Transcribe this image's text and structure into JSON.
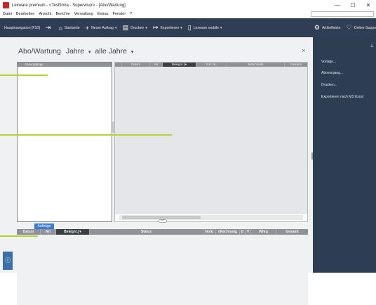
{
  "window": {
    "title": "Lexware premium - <Testfirma - Supervisor> - [Abo/Wartung]",
    "minimize": "—",
    "maximize": "☐",
    "close": "✕"
  },
  "menu": {
    "items": [
      "Datei",
      "Bearbeiten",
      "Ansicht",
      "Berichte",
      "Verwaltung",
      "Extras",
      "Fenster",
      "?"
    ]
  },
  "toolbar": {
    "nav": "Hauptnavigation [F10]",
    "startseite": "Startseite",
    "neuer_auftrag": "Neuer Auftrag",
    "drucken": "Drucken",
    "exportieren": "Exportieren",
    "lexware_mobile": "Lexware mobile",
    "artikelleiste": "Artikelleiste",
    "online_support": "Online Suppo"
  },
  "page": {
    "title": "Abo/Wartung",
    "year_label": "Jahre",
    "year_value": "alle Jahre",
    "close": "×"
  },
  "left_list": {
    "header": "Abovorgänge"
  },
  "grid": {
    "columns": [
      "",
      "Datum",
      "Art",
      "Belegnr.",
      "Ext. Nr.",
      "Matchcode",
      "Gesamt"
    ]
  },
  "orders": {
    "tab": "Aufträge",
    "columns": [
      "Datum",
      "Art",
      "Belegnr.",
      "Status",
      "Notiz",
      "eRechnung",
      "D",
      "V",
      "Whrg",
      "Gesamt"
    ]
  },
  "right_panel": {
    "items": [
      "Vorlage...",
      "Abovorgang...",
      "Drucken...",
      "Exportieren nach MS Excel"
    ]
  },
  "colors": {
    "toolbar_bg": "#2f3e54",
    "panel_bg": "#2d3d52",
    "accent": "#3b7ad6",
    "highlight_line": "#b7d13a"
  }
}
